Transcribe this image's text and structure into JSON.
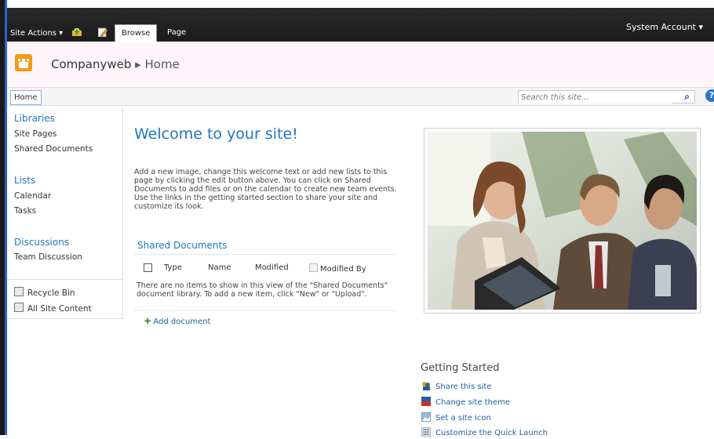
{
  "ribbon": {
    "site_actions": "Site Actions ▾",
    "tabs": [
      "Browse",
      "Page"
    ],
    "user": "System Account ▾"
  },
  "header": {
    "site_name": "Companyweb",
    "breadcrumb_sep": "▸",
    "page_name": "Home"
  },
  "topnav": {
    "home_tab": "Home",
    "search_placeholder": "Search this site...",
    "help": "?"
  },
  "quicklaunch": {
    "libraries": {
      "heading": "Libraries",
      "items": [
        "Site Pages",
        "Shared Documents"
      ]
    },
    "lists": {
      "heading": "Lists",
      "items": [
        "Calendar",
        "Tasks"
      ]
    },
    "discussions": {
      "heading": "Discussions",
      "items": [
        "Team Discussion"
      ]
    },
    "recycle_bin": "Recycle Bin",
    "all_site_content": "All Site Content"
  },
  "main": {
    "welcome": "Welcome to your site!",
    "intro": "Add a new image, change this welcome text or add new lists to this page by clicking the edit button above. You can click on Shared Documents to add files or on the calendar to create new team events. Use the links in the getting started section to share your site and customize its look.",
    "shared_docs": {
      "title": "Shared Documents",
      "columns": [
        "Type",
        "Name",
        "Modified",
        "Modified By"
      ],
      "empty_text": "There are no items to show in this view of the \"Shared Documents\" document library. To add a new item, click \"New\" or \"Upload\".",
      "add_link": "Add document"
    }
  },
  "getting_started": {
    "heading": "Getting Started",
    "links": [
      "Share this site",
      "Change site theme",
      "Set a site icon",
      "Customize the Quick Launch"
    ]
  },
  "colors": {
    "accent": "#1e76c2",
    "ribbon": "#1b1b1b",
    "header_bg": "#fff5fb",
    "logo": "#f39b17"
  }
}
